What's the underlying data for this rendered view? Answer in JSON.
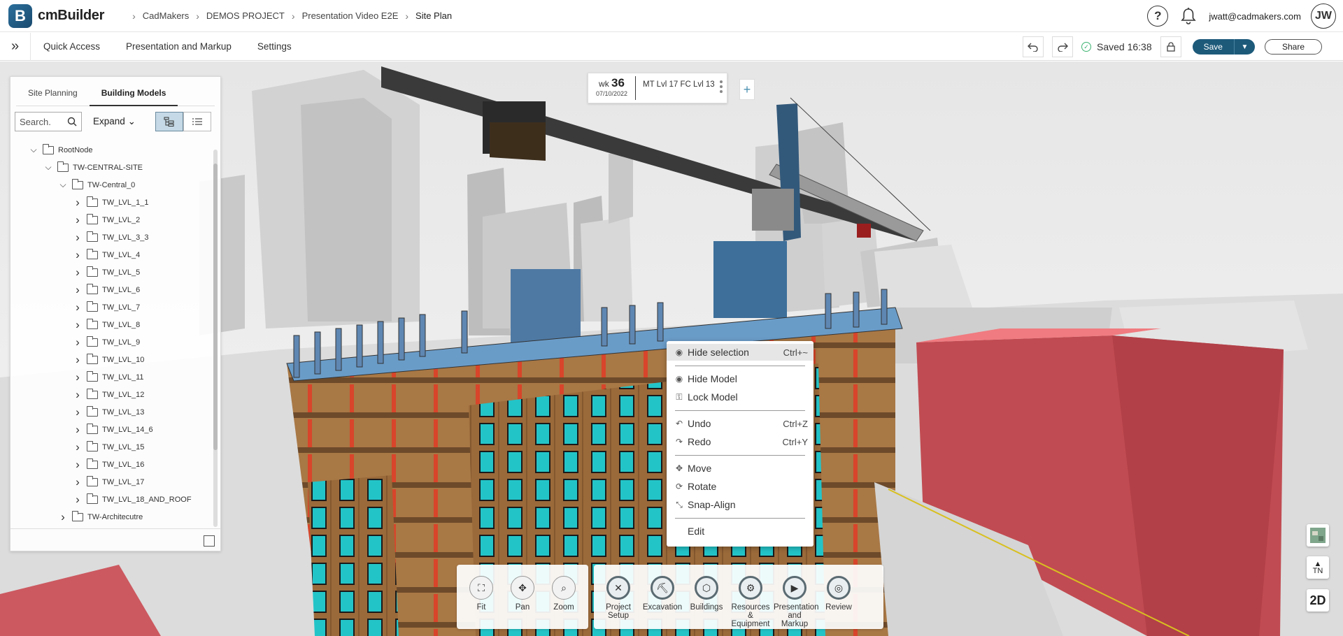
{
  "app": {
    "logo_letter": "B",
    "logo_text": "cmBuilder"
  },
  "breadcrumb": [
    "CadMakers",
    "DEMOS PROJECT",
    "Presentation Video E2E",
    "Site Plan"
  ],
  "header": {
    "help": "?",
    "user_email": "jwatt@cadmakers.com",
    "avatar_initials": "JW"
  },
  "menubar": {
    "expand": "»",
    "items": [
      "Quick Access",
      "Presentation and Markup",
      "Settings"
    ],
    "saved": "Saved 16:38",
    "save": "Save",
    "share": "Share"
  },
  "panel": {
    "tabs": [
      "Site Planning",
      "Building Models"
    ],
    "active_tab": "Building Models",
    "search_placeholder": "Search..",
    "search_value": "Search.",
    "expand_label": "Expand",
    "tree": [
      {
        "label": "RootNode",
        "level": 0,
        "expanded": true
      },
      {
        "label": "TW-CENTRAL-SITE",
        "level": 1,
        "expanded": true
      },
      {
        "label": "TW-Central_0",
        "level": 2,
        "expanded": true
      },
      {
        "label": "TW_LVL_1_1",
        "level": 3,
        "expanded": false
      },
      {
        "label": "TW_LVL_2",
        "level": 3,
        "expanded": false
      },
      {
        "label": "TW_LVL_3_3",
        "level": 3,
        "expanded": false
      },
      {
        "label": "TW_LVL_4",
        "level": 3,
        "expanded": false
      },
      {
        "label": "TW_LVL_5",
        "level": 3,
        "expanded": false
      },
      {
        "label": "TW_LVL_6",
        "level": 3,
        "expanded": false
      },
      {
        "label": "TW_LVL_7",
        "level": 3,
        "expanded": false
      },
      {
        "label": "TW_LVL_8",
        "level": 3,
        "expanded": false
      },
      {
        "label": "TW_LVL_9",
        "level": 3,
        "expanded": false
      },
      {
        "label": "TW_LVL_10",
        "level": 3,
        "expanded": false
      },
      {
        "label": "TW_LVL_11",
        "level": 3,
        "expanded": false
      },
      {
        "label": "TW_LVL_12",
        "level": 3,
        "expanded": false
      },
      {
        "label": "TW_LVL_13",
        "level": 3,
        "expanded": false
      },
      {
        "label": "TW_LVL_14_6",
        "level": 3,
        "expanded": false
      },
      {
        "label": "TW_LVL_15",
        "level": 3,
        "expanded": false
      },
      {
        "label": "TW_LVL_16",
        "level": 3,
        "expanded": false
      },
      {
        "label": "TW_LVL_17",
        "level": 3,
        "expanded": false
      },
      {
        "label": "TW_LVL_18_AND_ROOF",
        "level": 3,
        "expanded": false
      },
      {
        "label": "TW-Architecutre",
        "level": 2,
        "expanded": false
      }
    ]
  },
  "week": {
    "prefix": "wk",
    "number": "36",
    "date": "07/10/2022",
    "label": "MT Lvl 17 FC Lvl 13",
    "add": "+"
  },
  "context_menu": [
    {
      "label": "Hide selection",
      "shortcut": "Ctrl+~",
      "icon": "eye-icon",
      "highlighted": true
    },
    {
      "label": "Hide Model",
      "shortcut": "",
      "icon": "eye-icon"
    },
    {
      "label": "Lock Model",
      "shortcut": "",
      "icon": "lock-icon"
    },
    {
      "label": "Undo",
      "shortcut": "Ctrl+Z",
      "icon": "undo-icon"
    },
    {
      "label": "Redo",
      "shortcut": "Ctrl+Y",
      "icon": "redo-icon"
    },
    {
      "label": "Move",
      "shortcut": "",
      "icon": "move-icon"
    },
    {
      "label": "Rotate",
      "shortcut": "",
      "icon": "rotate-icon"
    },
    {
      "label": "Snap-Align",
      "shortcut": "",
      "icon": "snap-icon"
    },
    {
      "label": "Edit",
      "shortcut": "",
      "icon": ""
    }
  ],
  "toolbar_view": [
    {
      "label": "Fit",
      "icon": "fit-icon"
    },
    {
      "label": "Pan",
      "icon": "pan-icon"
    },
    {
      "label": "Zoom",
      "icon": "zoom-icon"
    }
  ],
  "toolbar_tools": [
    {
      "label": "Project Setup",
      "icon": "tools-icon"
    },
    {
      "label": "Excavation",
      "icon": "excavation-icon"
    },
    {
      "label": "Buildings",
      "icon": "buildings-icon"
    },
    {
      "label": "Resources & Equipment",
      "icon": "equipment-icon"
    },
    {
      "label": "Presentation and Markup",
      "icon": "presentation-icon"
    },
    {
      "label": "Review",
      "icon": "review-icon"
    }
  ],
  "side_controls": {
    "north": "TN",
    "north_arrow": "▲",
    "mode": "2D"
  },
  "colors": {
    "accent": "#1d5a7a",
    "saved_ok": "#3cb371",
    "building_red": "#c9505a",
    "glass_cyan": "#2bc9c9"
  }
}
